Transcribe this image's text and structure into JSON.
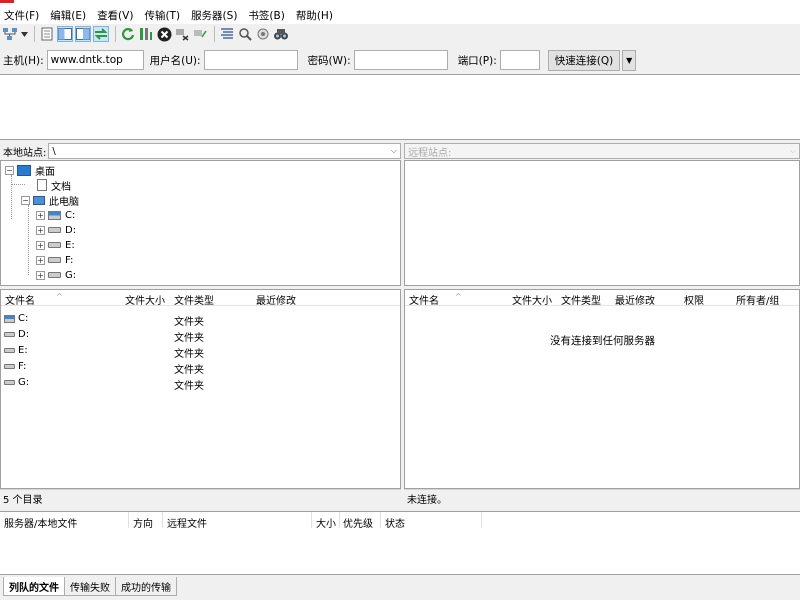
{
  "menu": [
    "文件(F)",
    "编辑(E)",
    "查看(V)",
    "传输(T)",
    "服务器(S)",
    "书签(B)",
    "帮助(H)"
  ],
  "toolbar_icons": [
    "site-manager-icon",
    "dropdown-arrow-icon",
    "toggle-log-icon",
    "toggle-local-tree-icon",
    "toggle-remote-tree-icon",
    "toggle-queue-icon",
    "refresh-icon",
    "process-queue-icon",
    "cancel-icon",
    "disconnect-icon",
    "reconnect-icon",
    "filter-icon",
    "compare-icon",
    "sync-browse-icon",
    "search-icon"
  ],
  "quickconnect": {
    "host_label": "主机(H):",
    "host_value": "www.dntk.top",
    "user_label": "用户名(U):",
    "user_value": "",
    "pass_label": "密码(W):",
    "pass_value": "",
    "port_label": "端口(P):",
    "port_value": "",
    "connect_button": "快速连接(Q)"
  },
  "local": {
    "site_label": "本地站点:",
    "path": "\\",
    "tree": {
      "desktop": "桌面",
      "documents": "文档",
      "this_pc": "此电脑",
      "drives": [
        "C:",
        "D:",
        "E:",
        "F:",
        "G:"
      ]
    },
    "columns": [
      "文件名",
      "文件大小",
      "文件类型",
      "最近修改"
    ],
    "rows": [
      {
        "name": "C:",
        "type": "文件夹"
      },
      {
        "name": "D:",
        "type": "文件夹"
      },
      {
        "name": "E:",
        "type": "文件夹"
      },
      {
        "name": "F:",
        "type": "文件夹"
      },
      {
        "name": "G:",
        "type": "文件夹"
      }
    ],
    "status": "5 个目录"
  },
  "remote": {
    "site_label": "远程站点:",
    "columns": [
      "文件名",
      "文件大小",
      "文件类型",
      "最近修改",
      "权限",
      "所有者/组"
    ],
    "empty_message": "没有连接到任何服务器",
    "status": "未连接。"
  },
  "queue": {
    "columns": [
      "服务器/本地文件",
      "方向",
      "远程文件",
      "大小",
      "优先级",
      "状态"
    ]
  },
  "tabs": [
    {
      "label": "列队的文件",
      "active": true
    },
    {
      "label": "传输失败",
      "active": false
    },
    {
      "label": "成功的传输",
      "active": false
    }
  ]
}
